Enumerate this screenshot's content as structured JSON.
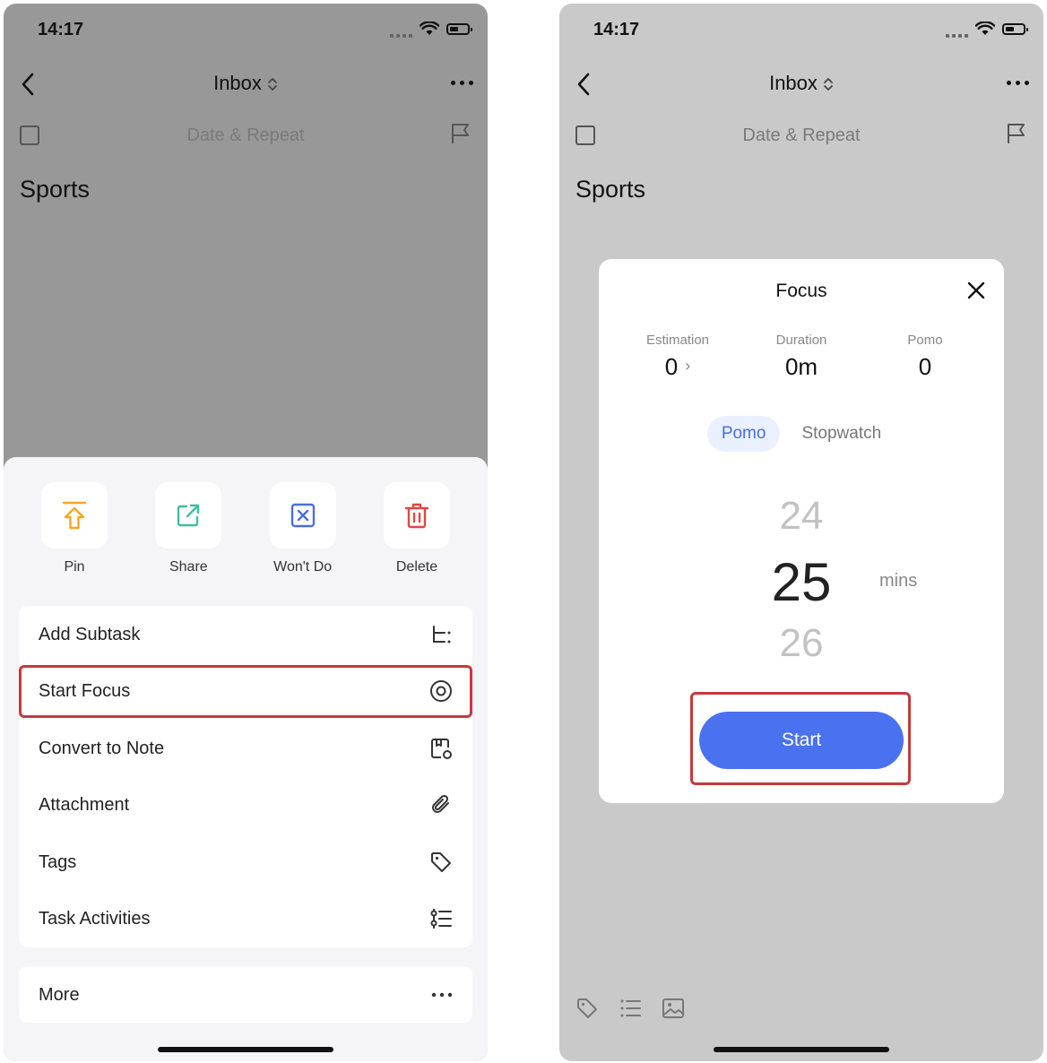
{
  "status": {
    "time": "14:17"
  },
  "nav": {
    "title": "Inbox"
  },
  "task": {
    "date_placeholder": "Date & Repeat",
    "title": "Sports"
  },
  "quick_actions": [
    {
      "label": "Pin",
      "icon": "pin-icon",
      "color": "#f5a623"
    },
    {
      "label": "Share",
      "icon": "share-icon",
      "color": "#3dbf9b"
    },
    {
      "label": "Won't Do",
      "icon": "wont-do-icon",
      "color": "#4a6ee0"
    },
    {
      "label": "Delete",
      "icon": "trash-icon",
      "color": "#e04646"
    }
  ],
  "menu": {
    "items": [
      {
        "label": "Add Subtask",
        "icon": "subtask-icon"
      },
      {
        "label": "Start Focus",
        "icon": "focus-icon"
      },
      {
        "label": "Convert to Note",
        "icon": "note-icon"
      },
      {
        "label": "Attachment",
        "icon": "paperclip-icon"
      },
      {
        "label": "Tags",
        "icon": "tag-icon"
      },
      {
        "label": "Task Activities",
        "icon": "activities-icon"
      }
    ],
    "more_label": "More"
  },
  "focus": {
    "title": "Focus",
    "stats": [
      {
        "label": "Estimation",
        "value": "0"
      },
      {
        "label": "Duration",
        "value": "0m"
      },
      {
        "label": "Pomo",
        "value": "0"
      }
    ],
    "tabs": [
      {
        "label": "Pomo",
        "active": true
      },
      {
        "label": "Stopwatch",
        "active": false
      }
    ],
    "picker": {
      "prev": "24",
      "current": "25",
      "next": "26",
      "unit": "mins"
    },
    "start_label": "Start"
  },
  "colors": {
    "accent": "#4a72f0",
    "highlight": "#c9383c"
  }
}
